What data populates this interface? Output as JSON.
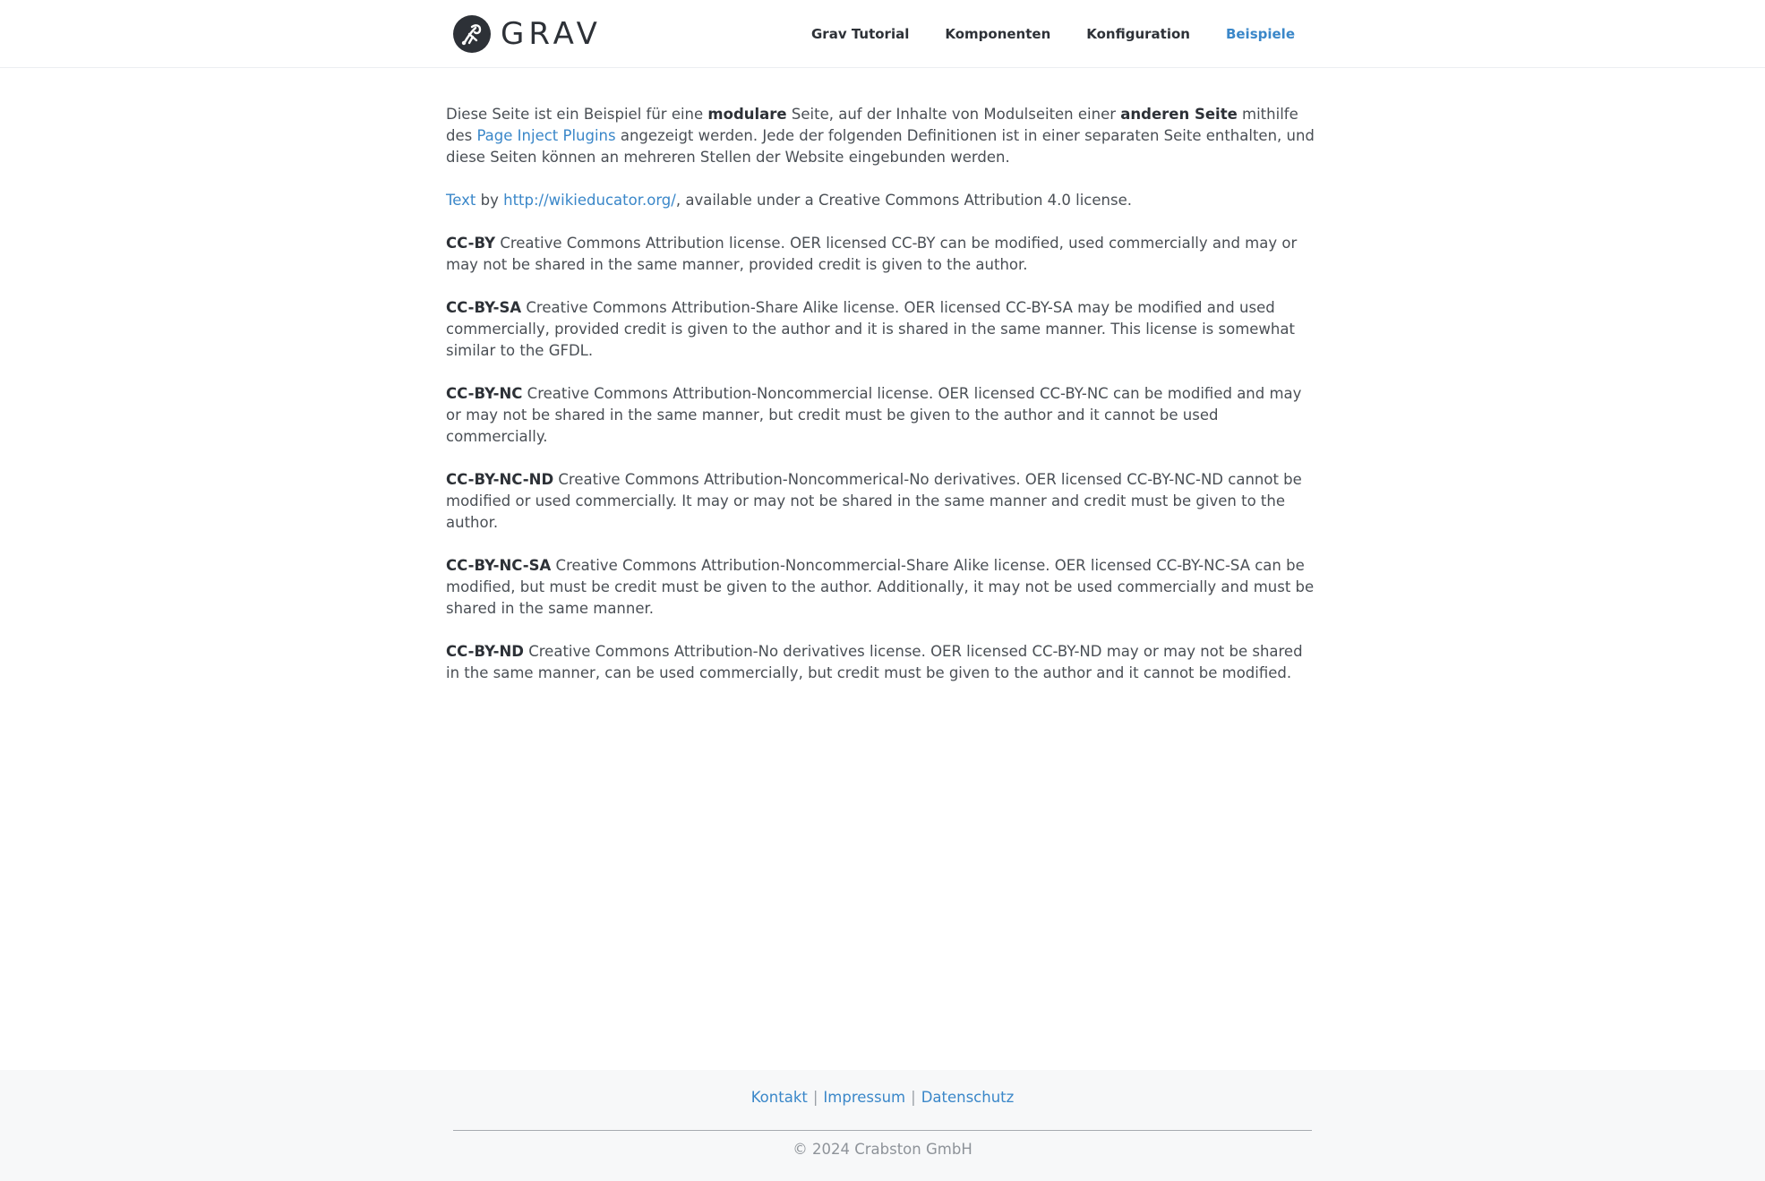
{
  "header": {
    "logo_text": "GRAV",
    "nav": [
      {
        "label": "Grav Tutorial",
        "active": false
      },
      {
        "label": "Komponenten",
        "active": false
      },
      {
        "label": "Konfiguration",
        "active": false
      },
      {
        "label": "Beispiele",
        "active": true
      }
    ]
  },
  "intro": {
    "t1": "Diese Seite ist ein Beispiel für eine ",
    "b1": "modulare",
    "t2": " Seite, auf der Inhalte von Modulseiten einer ",
    "b2": "anderen Seite",
    "t3": " mithilfe des ",
    "link": "Page Inject Plugins",
    "t4": " angezeigt werden. Jede der folgenden Definitionen ist in einer separaten Seite enthalten, und diese Seiten können an mehreren Stellen der Website eingebunden werden."
  },
  "attribution": {
    "text_link": "Text",
    "by": " by ",
    "url_link": "http://wikieducator.org/",
    "rest": ", available under a Creative Commons Attribution 4.0 license."
  },
  "licenses": [
    {
      "code": "CC-BY",
      "text": " Creative Commons Attribution license. OER licensed CC-BY can be modified, used commercially and may or may not be shared in the same manner, provided credit is given to the author."
    },
    {
      "code": "CC-BY-SA",
      "text": " Creative Commons Attribution-Share Alike license. OER licensed CC-BY-SA may be modified and used commercially, provided credit is given to the author and it is shared in the same manner. This license is somewhat similar to the GFDL."
    },
    {
      "code": "CC-BY-NC",
      "text": " Creative Commons Attribution-Noncommercial license. OER licensed CC-BY-NC can be modified and may or may not be shared in the same manner, but credit must be given to the author and it cannot be used commercially."
    },
    {
      "code": "CC-BY-NC-ND",
      "text": " Creative Commons Attribution-Noncommerical-No derivatives. OER licensed CC-BY-NC-ND cannot be modified or used commercially. It may or may not be shared in the same manner and credit must be given to the author."
    },
    {
      "code": "CC-BY-NC-SA",
      "text": " Creative Commons Attribution-Noncommercial-Share Alike license. OER licensed CC-BY-NC-SA can be modified, but must be credit must be given to the author. Additionally, it may not be used commercially and must be shared in the same manner."
    },
    {
      "code": "CC-BY-ND",
      "text": " Creative Commons Attribution-No derivatives license. OER licensed CC-BY-ND may or may not be shared in the same manner, can be used commercially, but credit must be given to the author and it cannot be modified."
    }
  ],
  "footer": {
    "links": [
      "Kontakt",
      "Impressum",
      "Datenschutz"
    ],
    "separator": "|",
    "copyright": "© 2024 Crabston GmbH"
  },
  "colors": {
    "link": "#3a87c9",
    "text": "#4a4f55",
    "heading": "#2d3137",
    "footer_bg": "#f7f8f9"
  }
}
